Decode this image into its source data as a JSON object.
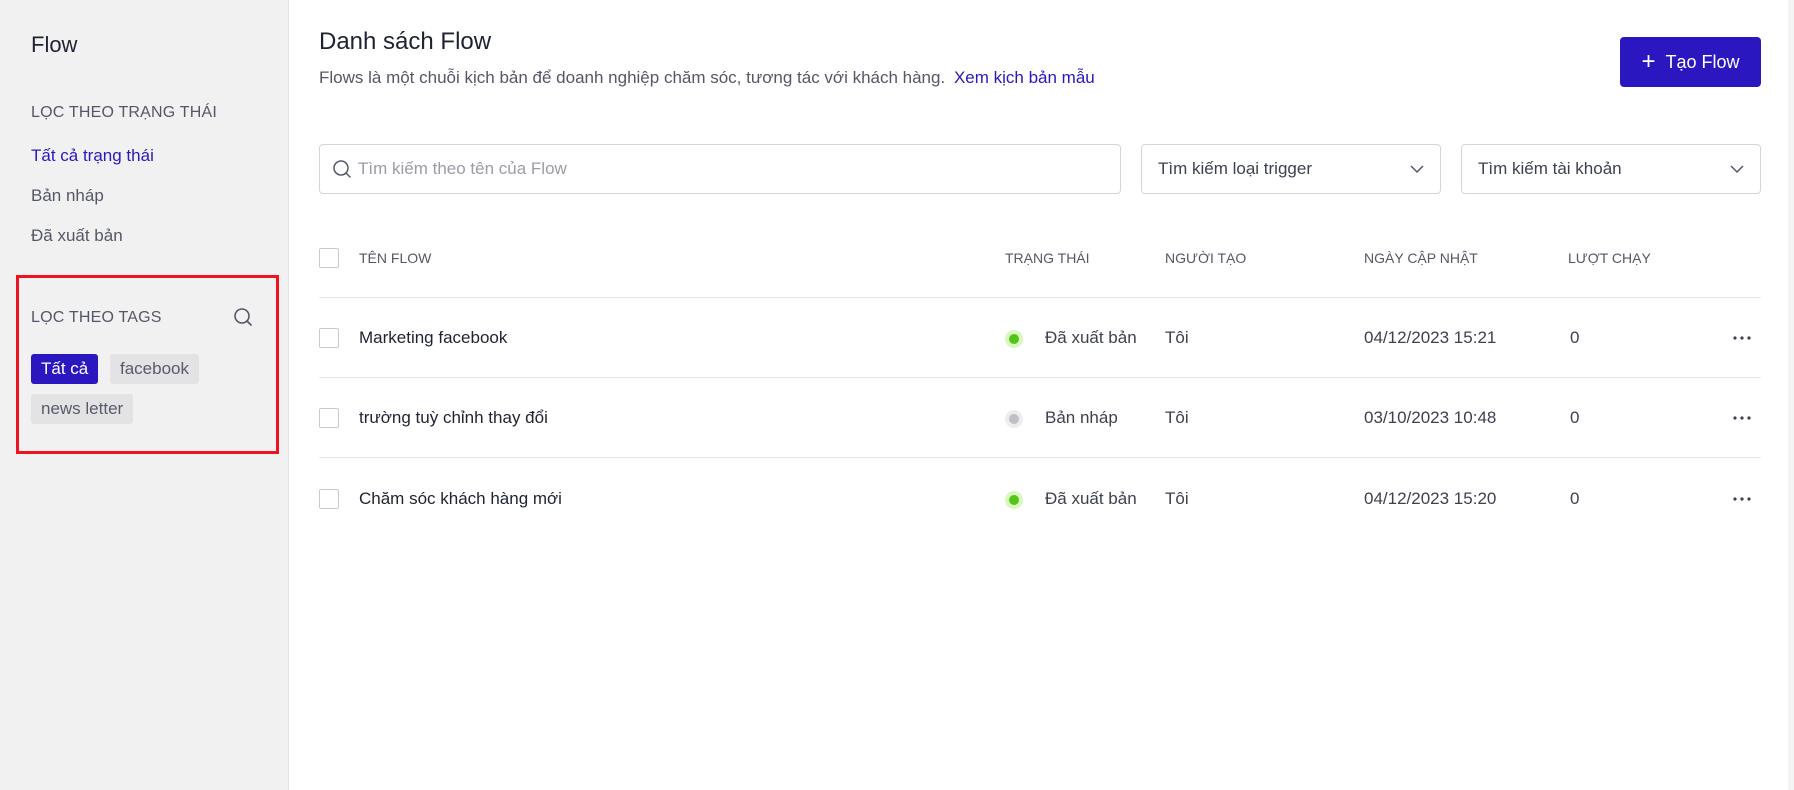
{
  "sidebar": {
    "title": "Flow",
    "status_filter": {
      "heading": "LỌC THEO TRẠNG THÁI",
      "items": [
        {
          "label": "Tất cả trạng thái",
          "active": true
        },
        {
          "label": "Bản nháp",
          "active": false
        },
        {
          "label": "Đã xuất bản",
          "active": false
        }
      ]
    },
    "tags_filter": {
      "heading": "LỌC THEO TAGS",
      "search_icon": "search-icon",
      "tags": [
        {
          "label": "Tất cả",
          "active": true
        },
        {
          "label": "facebook",
          "active": false
        },
        {
          "label": "news letter",
          "active": false
        }
      ]
    }
  },
  "header": {
    "title": "Danh sách Flow",
    "description": "Flows là một chuỗi kịch bản để doanh nghiệp chăm sóc, tương tác với khách hàng.",
    "link_label": "Xem kịch bản mẫu",
    "create_button": {
      "icon": "plus-icon",
      "label": "Tạo Flow"
    }
  },
  "filters": {
    "search": {
      "placeholder": "Tìm kiếm theo tên của Flow",
      "value": ""
    },
    "trigger_select": {
      "label": "Tìm kiếm loại trigger"
    },
    "account_select": {
      "label": "Tìm kiếm tài khoản"
    }
  },
  "table": {
    "columns": [
      "TÊN FLOW",
      "TRẠNG THÁI",
      "NGƯỜI TẠO",
      "NGÀY CẬP NHẬT",
      "LƯỢT CHẠY"
    ],
    "rows": [
      {
        "name": "Marketing facebook",
        "status": "Đã xuất bản",
        "status_type": "published",
        "creator": "Tôi",
        "updated": "04/12/2023 15:21",
        "runs": "0"
      },
      {
        "name": "trường tuỳ chỉnh thay đổi",
        "status": "Bản nháp",
        "status_type": "draft",
        "creator": "Tôi",
        "updated": "03/10/2023 10:48",
        "runs": "0"
      },
      {
        "name": "Chăm sóc khách hàng mới",
        "status": "Đã xuất bản",
        "status_type": "published",
        "creator": "Tôi",
        "updated": "04/12/2023 15:20",
        "runs": "0"
      }
    ]
  },
  "colors": {
    "accent": "#2a17c0",
    "published": "#52c41a",
    "published_halo": "#d9f7be",
    "draft": "#bfbfc4",
    "draft_halo": "#ededf0",
    "highlight_border": "#f0121f"
  }
}
